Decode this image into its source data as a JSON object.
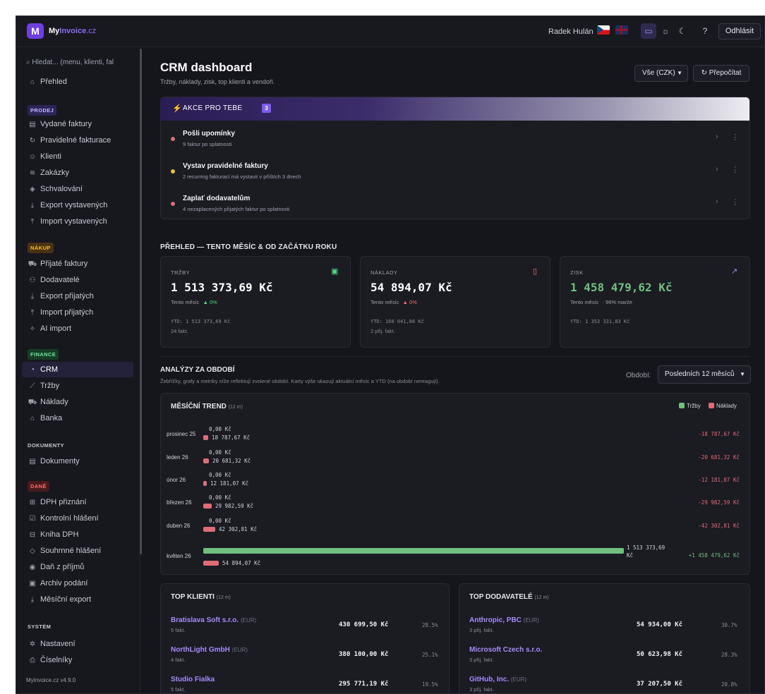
{
  "topbar": {
    "logo_letter": "M",
    "brand_my": "My",
    "brand_invoice": "Invoice",
    "brand_tld": ".cz",
    "user": "Radek Hulán",
    "logout": "Odhlásit"
  },
  "sidebar": {
    "search_placeholder": "Hledat... (menu, klienti, fal",
    "overview": "Přehled",
    "sections": {
      "prodej": "PRODEJ",
      "nakup": "NÁKUP",
      "finance": "FINANCE",
      "dokumenty": "DOKUMENTY",
      "dane": "DANĚ",
      "system": "SYSTÉM"
    },
    "prodej_items": [
      "Vydané faktury",
      "Pravidelné fakturace",
      "Klienti",
      "Zakázky",
      "Schvalování",
      "Export vystavených",
      "Import vystavených"
    ],
    "nakup_items": [
      "Přijaté faktury",
      "Dodavatelé",
      "Export přijatých",
      "Import přijatých",
      "AI import"
    ],
    "finance_items": [
      "CRM",
      "Tržby",
      "Náklady",
      "Banka"
    ],
    "dokumenty_items": [
      "Dokumenty"
    ],
    "dane_items": [
      "DPH přiznání",
      "Kontrolní hlášení",
      "Kniha DPH",
      "Souhrnné hlášení",
      "Daň z příjmů",
      "Archiv podání",
      "Měsíční export"
    ],
    "system_items": [
      "Nastavení",
      "Číselníky"
    ],
    "version": "MyInvoice.cz  v4.9.0"
  },
  "page": {
    "title": "CRM dashboard",
    "subtitle": "Tržby, náklady, zisk, top klienti a vendoři.",
    "currency_select": "Vše (CZK)",
    "recalc_button": "Přepočítat"
  },
  "actions": {
    "title": "AKCE PRO TEBE",
    "count": "3",
    "items": [
      {
        "title": "Pošli upomínky",
        "desc": "9 faktur po splatnosti",
        "color": "#e06c75"
      },
      {
        "title": "Vystav pravidelné faktury",
        "desc": "2 recurring fakturací má vystavit v příštích 3 dnech",
        "color": "#f5b942"
      },
      {
        "title": "Zaplať dodavatelům",
        "desc": "4 nezaplacených přijatých faktur po splatnosti",
        "color": "#e06c75"
      }
    ]
  },
  "overview": {
    "heading": "PŘEHLED — TENTO MĚSÍC & OD ZAČÁTKU ROKU",
    "cards": [
      {
        "label": "TRŽBY",
        "value": "1 513 373,69 Kč",
        "month_label": "Tento měsíc",
        "change": "▲ 0%",
        "change_color": "#4ade80",
        "ytd": "YTD: 1 513 373,69 Kč",
        "count": "24 fakt.",
        "value_color": "#ffffff",
        "icon_color": "#4ade80"
      },
      {
        "label": "NÁKLADY",
        "value": "54 894,07 Kč",
        "month_label": "Tento měsíc",
        "change": "▲ 0%",
        "change_color": "#f87171",
        "ytd": "YTD: 160 041,86 Kč",
        "count": "2 přij. fakt.",
        "value_color": "#ffffff",
        "icon_color": "#f87171"
      },
      {
        "label": "ZISK",
        "value": "1 458 479,62 Kč",
        "month_label": "Tento měsíc",
        "change": "· 96% marže",
        "change_color": "#a1a1aa",
        "ytd": "YTD: 1 353 331,83 Kč",
        "count": "",
        "value_color": "#6fbf7f",
        "icon_color": "#a78bfa"
      }
    ]
  },
  "analysis": {
    "heading": "ANALÝZY ZA OBDOBÍ",
    "subtitle": "Žebříčky, grafy a metriky níže reflektují zvolené období. Karty výše ukazují aktuální měsíc a YTD (na období nereagují).",
    "period_label": "Období:",
    "period_value": "Posledních 12 měsíců"
  },
  "trend": {
    "title": "MĚSÍČNÍ TREND",
    "title_suffix": "(12 m)",
    "legend_income": "Tržby",
    "legend_expense": "Náklady",
    "income_color": "#6fbf7f",
    "expense_color": "#e06c75"
  },
  "chart_data": {
    "type": "bar",
    "title": "MĚSÍČNÍ TREND (12 m)",
    "categories": [
      "prosinec 25",
      "leden 26",
      "únor 26",
      "březen 26",
      "duben 26",
      "květen 26"
    ],
    "series": [
      {
        "name": "Tržby",
        "values": [
          0,
          0,
          0,
          0,
          0,
          1513373.69
        ]
      },
      {
        "name": "Náklady",
        "values": [
          18787.67,
          20681.32,
          12181.07,
          29982.59,
          42302.81,
          54894.07
        ]
      }
    ],
    "income_labels": [
      "0,00 Kč",
      "0,00 Kč",
      "0,00 Kč",
      "0,00 Kč",
      "0,00 Kč",
      "1 513 373,69 Kč"
    ],
    "expense_labels": [
      "18 787,67 Kč",
      "20 681,32 Kč",
      "12 181,07 Kč",
      "29 982,59 Kč",
      "42 302,81 Kč",
      "54 894,07 Kč"
    ],
    "net_labels": [
      "-18 787,67 Kč",
      "-20 681,32 Kč",
      "-12 181,07 Kč",
      "-29 982,59 Kč",
      "-42 302,81 Kč",
      "+1 458 479,62 Kč"
    ],
    "xlim": [
      0,
      1513373.69
    ]
  },
  "top_clients": {
    "title": "TOP KLIENTI",
    "suffix": "(12 m)",
    "rows": [
      {
        "name": "Bratislava Soft s.r.o.",
        "ccy": "(EUR)",
        "count": "5 fakt.",
        "amount": "430 699,50 Kč",
        "pct": "28.5%"
      },
      {
        "name": "NorthLight GmbH",
        "ccy": "(EUR)",
        "count": "4 fakt.",
        "amount": "380 100,00 Kč",
        "pct": "25.1%"
      },
      {
        "name": "Studio Fialka",
        "ccy": "",
        "count": "5 fakt.",
        "amount": "295 771,19 Kč",
        "pct": "19.5%"
      }
    ]
  },
  "top_suppliers": {
    "title": "TOP DODAVATELÉ",
    "suffix": "(12 m)",
    "rows": [
      {
        "name": "Anthropic, PBC",
        "ccy": "(EUR)",
        "count": "3 přij. fakt.",
        "amount": "54 934,00 Kč",
        "pct": "30.7%"
      },
      {
        "name": "Microsoft Czech s.r.o.",
        "ccy": "",
        "count": "3 přij. fakt.",
        "amount": "50 623,98 Kč",
        "pct": "28.3%"
      },
      {
        "name": "GitHub, Inc.",
        "ccy": "(EUR)",
        "count": "3 přij. fakt.",
        "amount": "37 207,50 Kč",
        "pct": "20.8%"
      }
    ]
  }
}
